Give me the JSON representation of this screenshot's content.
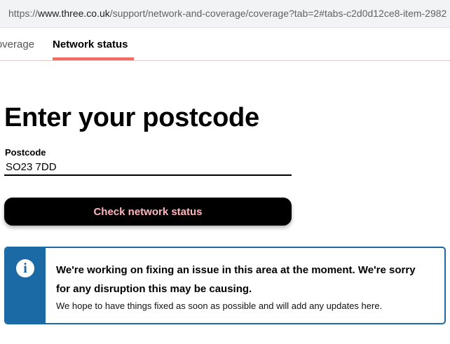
{
  "browser": {
    "url_prefix": "https://",
    "url_host": "www.three.co.uk",
    "url_path": "/support/network-and-coverage/coverage?tab=2#tabs-c2d0d12ce8-item-2982"
  },
  "tabs": {
    "coverage_label": "Coverage",
    "status_label": "Network status"
  },
  "main": {
    "heading": "Enter your postcode",
    "postcode_label": "Postcode",
    "postcode_value": "SO23 7DD",
    "check_button": "Check network status"
  },
  "alert": {
    "icon": "info-icon",
    "title": "We're working on fixing an issue in this area at the moment. We're sorry for any disruption this may be causing.",
    "body": "We hope to have things fixed as soon as possible and will add any updates here."
  },
  "colors": {
    "accent": "#f26b5e",
    "button_text": "#ffb6c1",
    "info_blue": "#1b6aa6"
  }
}
